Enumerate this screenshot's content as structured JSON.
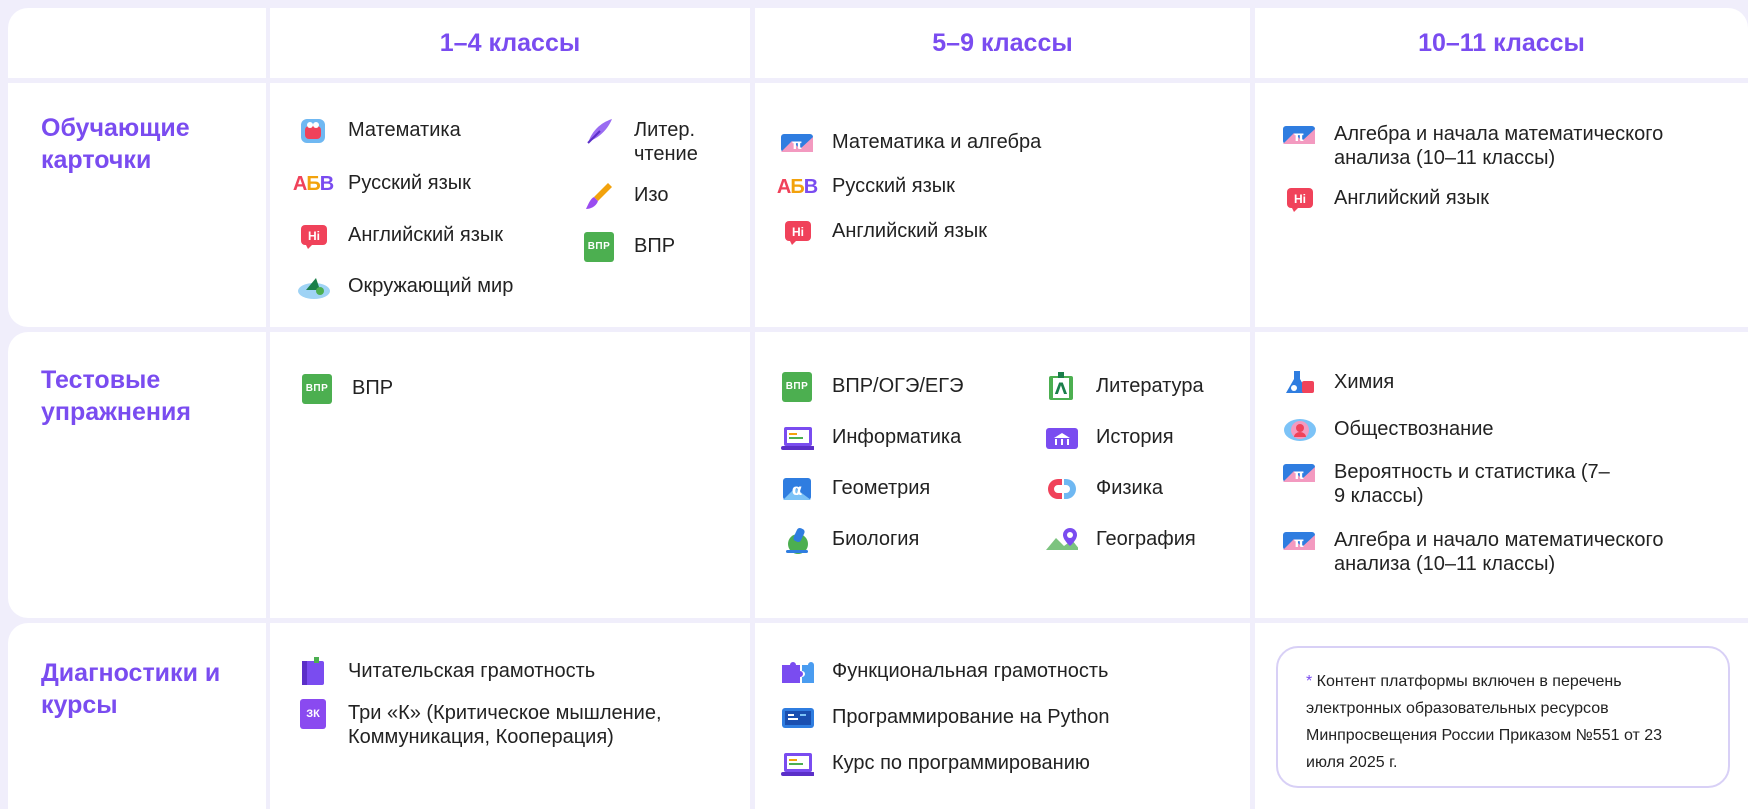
{
  "header": {
    "col1": "1–4 классы",
    "col2": "5–9 классы",
    "col3": "10–11 классы"
  },
  "rows": {
    "cards": "Обучающие карточки",
    "tests": "Тестовые упражнения",
    "diag": "Диагностики и курсы"
  },
  "cards": {
    "g14": [
      {
        "label": "Математика",
        "icon": "math-kid-icon"
      },
      {
        "label": "Русский язык",
        "icon": "abv-icon"
      },
      {
        "label": "Английский язык",
        "icon": "hi-icon"
      },
      {
        "label": "Окружающий мир",
        "icon": "world-bird-icon"
      },
      {
        "label": "Литер. чтение",
        "icon": "feather-icon"
      },
      {
        "label": "Изо",
        "icon": "brush-icon"
      },
      {
        "label": "ВПР",
        "icon": "vpr-icon"
      }
    ],
    "g59": [
      {
        "label": "Математика и алгебра",
        "icon": "pi-icon"
      },
      {
        "label": "Русский язык",
        "icon": "abv-icon"
      },
      {
        "label": "Английский язык",
        "icon": "hi-icon"
      }
    ],
    "g1011": [
      {
        "label": "Алгебра и начала математического анализа (10–11 классы)",
        "icon": "pi-icon"
      },
      {
        "label": "Английский язык",
        "icon": "hi-icon"
      }
    ]
  },
  "tests": {
    "g14": [
      {
        "label": "ВПР",
        "icon": "vpr-icon"
      }
    ],
    "g59": [
      {
        "label": "ВПР/ОГЭ/ЕГЭ",
        "icon": "vpr-icon"
      },
      {
        "label": "Информатика",
        "icon": "laptop-icon"
      },
      {
        "label": "Геометрия",
        "icon": "alpha-icon"
      },
      {
        "label": "Биология",
        "icon": "microscope-icon"
      },
      {
        "label": "Литература",
        "icon": "book-lambda-icon"
      },
      {
        "label": "История",
        "icon": "museum-icon"
      },
      {
        "label": "Физика",
        "icon": "magnet-icon"
      },
      {
        "label": "География",
        "icon": "map-pin-icon"
      }
    ],
    "g1011": [
      {
        "label": "Химия",
        "icon": "flask-icon"
      },
      {
        "label": "Обществознание",
        "icon": "society-icon"
      },
      {
        "label": "Вероятность и статистика (7–9 классы)",
        "icon": "pi-icon"
      },
      {
        "label": "Алгебра и начало математического анализа (10–11 классы)",
        "icon": "pi-icon"
      }
    ]
  },
  "diag": {
    "g14": [
      {
        "label": "Читательская грамотность",
        "icon": "book-purple-icon"
      },
      {
        "label": "Три «К» (Критическое мышление, Коммуникация, Кооперация)",
        "icon": "zk-icon"
      }
    ],
    "g59": [
      {
        "label": "Функциональная грамотность",
        "icon": "puzzle-icon"
      },
      {
        "label": "Программирование на Python",
        "icon": "code-screen-icon"
      },
      {
        "label": "Курс по программированию",
        "icon": "laptop-icon"
      }
    ]
  },
  "note": {
    "star": "*",
    "text": " Контент платформы включен в перечень электронных образовательных ресурсов Минпросвещения России Приказом №551 от 23 июля 2025 г."
  },
  "badges": {
    "vpr": "ВПР",
    "zk": "ЗК",
    "abv": "АБВ",
    "hi": "Hi",
    "pi": "π",
    "alpha": "α"
  },
  "colors": {
    "accent": "#7a4cf0",
    "background": "#f0eefb",
    "vpr_green": "#4caf50",
    "hi_red": "#f0425a",
    "pi_blue": "#2f7de0"
  }
}
